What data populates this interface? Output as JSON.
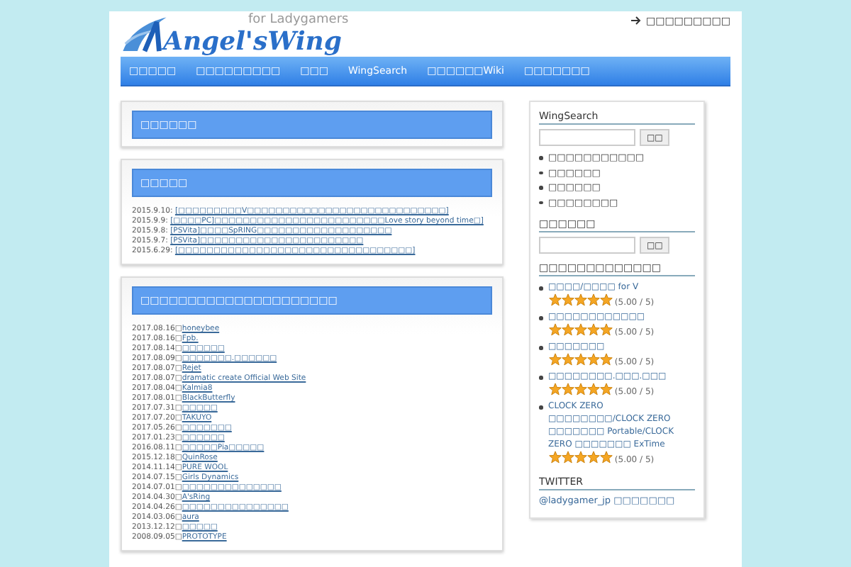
{
  "header": {
    "logo_title": "Angel'sWing",
    "logo_tagline": "for Ladygamers",
    "top_link": "□□□□□□□□□"
  },
  "nav": [
    {
      "label": "□□□□□"
    },
    {
      "label": "□□□□□□□□□"
    },
    {
      "label": "□□□"
    },
    {
      "label": "WingSearch"
    },
    {
      "label": "□□□□□□Wiki"
    },
    {
      "label": "□□□□□□□"
    }
  ],
  "main": [
    {
      "title": "□□□□□□"
    },
    {
      "title": "□□□□□",
      "entries": [
        {
          "date": "2015.9.10: ",
          "link": "[□□□□□□□□□V□□□□□□□□□□□□□□□□□□□□□□□□□□□□]"
        },
        {
          "date": "2015.9.9: ",
          "link": "[□□□□PC]□□□□□□□□□□□□□□□□□□□□□□□□Love story beyond time□]"
        },
        {
          "date": "2015.9.8: ",
          "link": "[PSVita]□□□□SpRING□□□□□□□□□□□□□□□□□□□"
        },
        {
          "date": "2015.9.7: ",
          "link": "[PSVita]□□□□□□□□□□□□□□□□□□□□□□□"
        },
        {
          "date": "2015.6.29: ",
          "link": "[□□□□□□□□□□□□□□□□□□□□□□□□□□□□□□□□□]"
        }
      ]
    },
    {
      "title": "□□□□□□□□□□□□□□□□□□□□□",
      "entries": [
        {
          "date": "2017.08.16□",
          "link": "honeybee"
        },
        {
          "date": "2017.08.16□",
          "link": "Fpb."
        },
        {
          "date": "2017.08.14□",
          "link": "□□□□□□"
        },
        {
          "date": "2017.08.09□",
          "link": "□□□□□□□.□□□□□□"
        },
        {
          "date": "2017.08.07□",
          "link": "Rejet"
        },
        {
          "date": "2017.08.07□",
          "link": "dramatic create Official Web Site"
        },
        {
          "date": "2017.08.04□",
          "link": "Kalmia8"
        },
        {
          "date": "2017.08.01□",
          "link": "BlackButterfly"
        },
        {
          "date": "2017.07.31□",
          "link": "□□□□□"
        },
        {
          "date": "2017.07.20□",
          "link": "TAKUYO"
        },
        {
          "date": "2017.05.26□",
          "link": "□□□□□□□"
        },
        {
          "date": "2017.01.23□",
          "link": "□□□□□□"
        },
        {
          "date": "2016.08.11□",
          "link": "□□□□□Pia□□□□□"
        },
        {
          "date": "2015.12.18□",
          "link": "QuinRose"
        },
        {
          "date": "2014.11.14□",
          "link": "PURE WOOL"
        },
        {
          "date": "2014.07.15□",
          "link": "Girls Dynamics"
        },
        {
          "date": "2014.07.01□",
          "link": "□□□□□□□□□□□□□□"
        },
        {
          "date": "2014.04.30□",
          "link": "A'sRing"
        },
        {
          "date": "2014.04.26□",
          "link": "□□□□□□□□□□□□□□□"
        },
        {
          "date": "2014.03.06□",
          "link": "aura"
        },
        {
          "date": "2013.12.12□",
          "link": "□□□□□"
        },
        {
          "date": "2008.09.05□",
          "link": "PROTOTYPE"
        }
      ]
    }
  ],
  "sidebar": {
    "wingsearch": {
      "title": "WingSearch",
      "button": "□□",
      "links": [
        "□□□□□□□□□□□",
        "□□□□□□",
        "□□□□□□",
        "□□□□□□□□"
      ]
    },
    "search": {
      "title": "□□□□□□",
      "button": "□□"
    },
    "ratings": {
      "title": "□□□□□□□□□□□□□",
      "items": [
        {
          "link": "□□□□/□□□□ for V",
          "stars": 5,
          "score": "(5.00 / 5)"
        },
        {
          "link": "□□□□□□□□□□□□",
          "stars": 5,
          "score": "(5.00 / 5)"
        },
        {
          "link": "□□□□□□□",
          "stars": 5,
          "score": "(5.00 / 5)"
        },
        {
          "link": "□□□□□□□□.□□□.□□□",
          "stars": 5,
          "score": "(5.00 / 5)"
        },
        {
          "link": "CLOCK ZERO □□□□□□□□/CLOCK ZERO □□□□□□□ Portable/CLOCK ZERO □□□□□□□ ExTime",
          "stars": 5,
          "score": "(5.00 / 5)"
        }
      ]
    },
    "twitter": {
      "title": "TWITTER",
      "link": "@ladygamer_jp □□□□□□□"
    }
  }
}
